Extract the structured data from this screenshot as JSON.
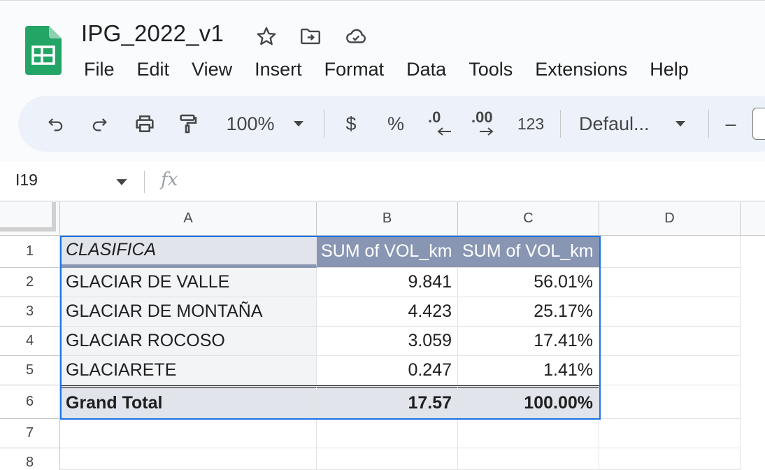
{
  "doc": {
    "title": "IPG_2022_v1",
    "icons": [
      "star-icon",
      "move-to-folder-icon",
      "cloud-saved-icon"
    ]
  },
  "menu": [
    "File",
    "Edit",
    "View",
    "Insert",
    "Format",
    "Data",
    "Tools",
    "Extensions",
    "Help"
  ],
  "toolbar": {
    "zoom": "100%",
    "currency": "$",
    "percent": "%",
    "decrease_decimal": ".0",
    "increase_decimal": ".00",
    "more_formats": "123",
    "font": "Defaul...",
    "minus": "–"
  },
  "formula_bar": {
    "cell_ref": "I19",
    "fx_label": "fx",
    "value": ""
  },
  "sheet": {
    "columns": [
      "A",
      "B",
      "C",
      "D"
    ],
    "rows": [
      "1",
      "2",
      "3",
      "4",
      "5",
      "6",
      "7",
      "8"
    ],
    "header": [
      "CLASIFICA",
      "SUM of VOL_km",
      "SUM of VOL_km"
    ],
    "data": [
      [
        "GLACIAR DE VALLE",
        "9.841",
        "56.01%"
      ],
      [
        "GLACIAR DE MONTAÑA",
        "4.423",
        "25.17%"
      ],
      [
        "GLACIAR ROCOSO",
        "3.059",
        "17.41%"
      ],
      [
        "GLACIARETE",
        "0.247",
        "1.41%"
      ]
    ],
    "total": [
      "Grand Total",
      "17.57",
      "100.00%"
    ]
  },
  "colors": {
    "pivot_header": "#8896b3",
    "pivot_light": "#e1e4eb",
    "selection": "#1a73e8",
    "sheets_green": "#0f9d58"
  }
}
